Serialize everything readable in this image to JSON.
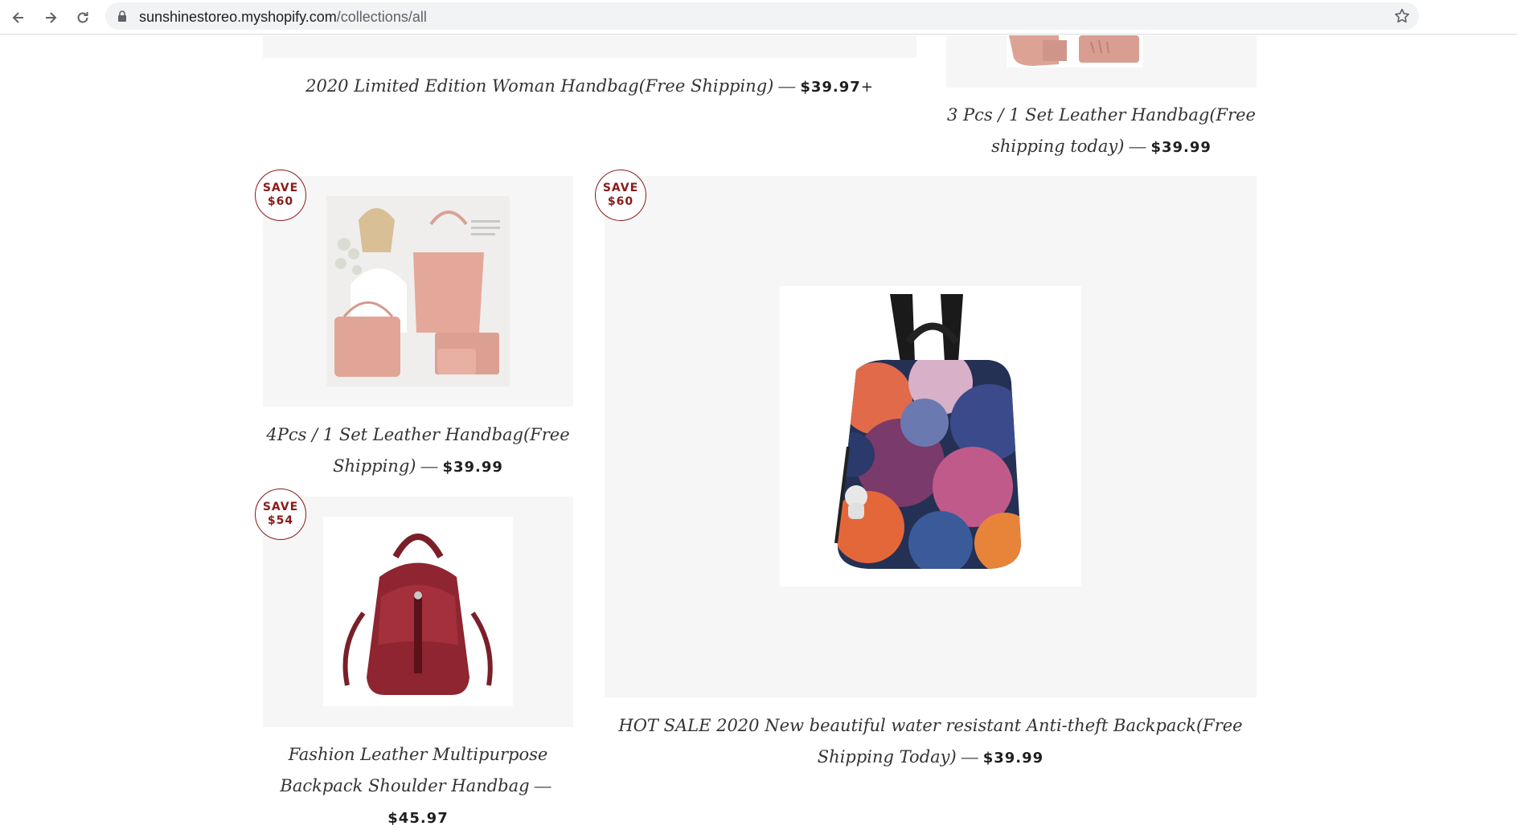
{
  "browser": {
    "url_domain": "sunshinestoreo.myshopify.com",
    "url_path": "/collections/all"
  },
  "products": [
    {
      "title": "2020 Limited Edition Woman Handbag(Free Shipping)",
      "separator": "—",
      "price": "$39.97",
      "price_suffix": "+"
    },
    {
      "title": "3 Pcs / 1 Set Leather Handbag(Free shipping today)",
      "separator": "—",
      "price": "$39.99"
    },
    {
      "title": "4Pcs / 1 Set Leather Handbag(Free Shipping)",
      "separator": "—",
      "price": "$39.99",
      "badge_top": "SAVE",
      "badge_amount": "$60"
    },
    {
      "title": "HOT SALE 2020 New beautiful water resistant Anti-theft Backpack(Free Shipping Today)",
      "separator": "—",
      "price": "$39.99",
      "badge_top": "SAVE",
      "badge_amount": "$60"
    },
    {
      "title": "Fashion Leather Multipurpose Backpack Shoulder Handbag",
      "separator": "—",
      "price": "$45.97",
      "badge_top": "SAVE",
      "badge_amount": "$54"
    }
  ],
  "colors": {
    "badge": "#8b1a1a",
    "card_bg": "#f6f6f6",
    "pink_bag": "#e3a89a",
    "red_bag": "#8e2530"
  },
  "icons": [
    "back-arrow-icon",
    "forward-arrow-icon",
    "reload-icon",
    "lock-icon",
    "bookmark-star-icon"
  ]
}
